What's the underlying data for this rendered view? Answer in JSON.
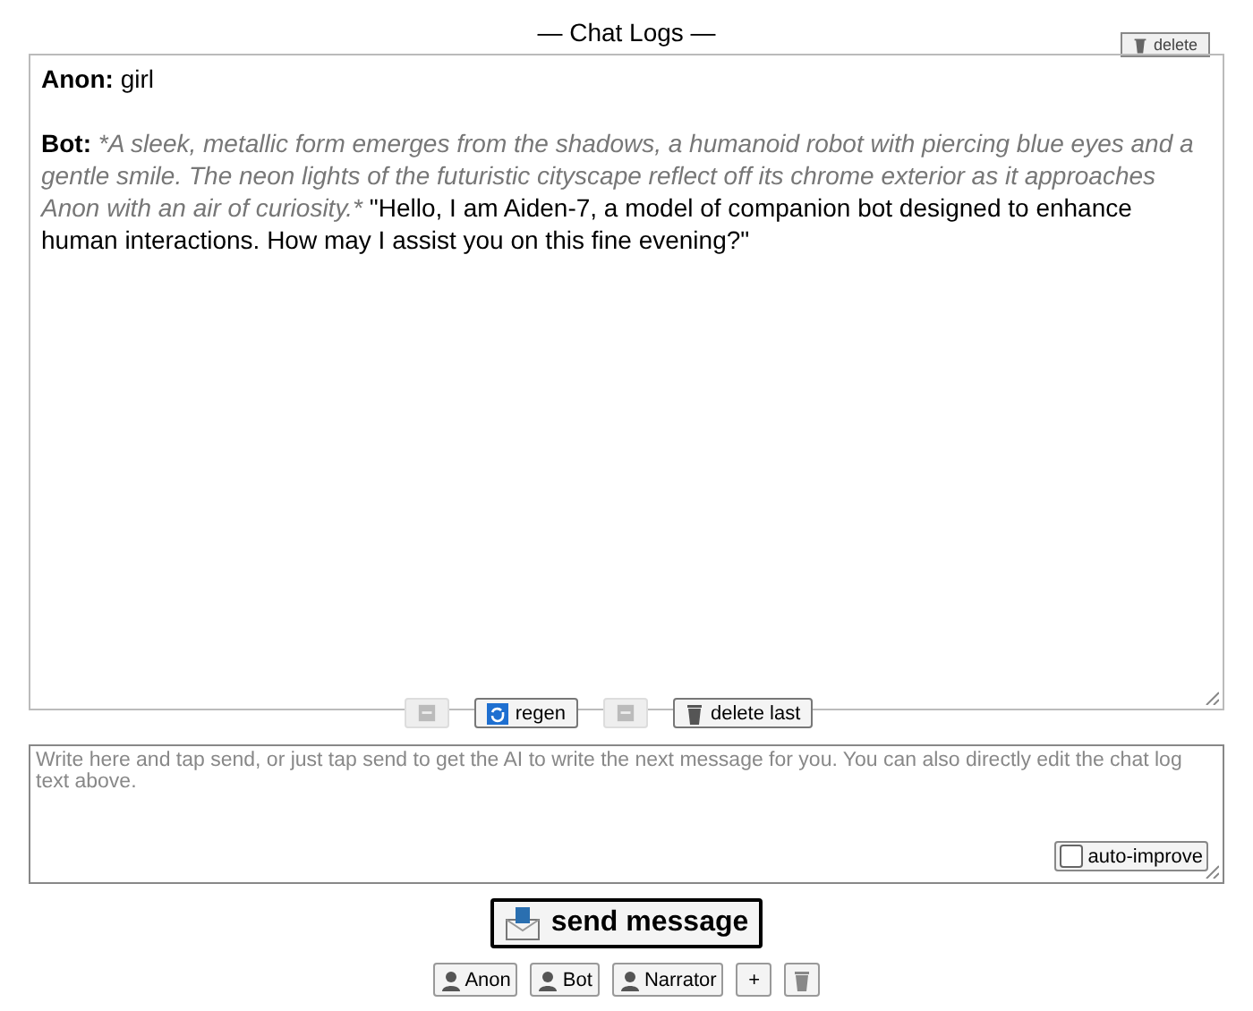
{
  "title": "— Chat Logs —",
  "delete_button": "delete",
  "messages": [
    {
      "speaker": "Anon:",
      "parts": [
        {
          "kind": "speech",
          "text": "girl"
        }
      ]
    },
    {
      "speaker": "Bot:",
      "parts": [
        {
          "kind": "action",
          "text": "*A sleek, metallic form emerges from the shadows, a humanoid robot with piercing blue eyes and a gentle smile. The neon lights of the futuristic cityscape reflect off its chrome exterior as it approaches Anon with an air of curiosity.*"
        },
        {
          "kind": "speech",
          "text": "\"Hello, I am Aiden-7, a model of companion bot designed to enhance human interactions. How may I assist you on this fine evening?\""
        }
      ]
    }
  ],
  "log_actions": [
    {
      "kind": "blank",
      "disabled": true
    },
    {
      "kind": "regen",
      "label": "regen",
      "disabled": false
    },
    {
      "kind": "blank",
      "disabled": true
    },
    {
      "kind": "trash",
      "label": "delete last",
      "disabled": false
    }
  ],
  "input": {
    "placeholder": "Write here and tap send, or just tap send to get the AI to write the next message for you. You can also directly edit the chat log text above."
  },
  "auto_improve": {
    "label": "auto-improve",
    "checked": false
  },
  "send_button": "send message",
  "speakers": [
    {
      "kind": "person",
      "label": "Anon"
    },
    {
      "kind": "person",
      "label": "Bot"
    },
    {
      "kind": "person",
      "label": "Narrator"
    },
    {
      "kind": "text",
      "label": "+"
    },
    {
      "kind": "trash"
    }
  ]
}
